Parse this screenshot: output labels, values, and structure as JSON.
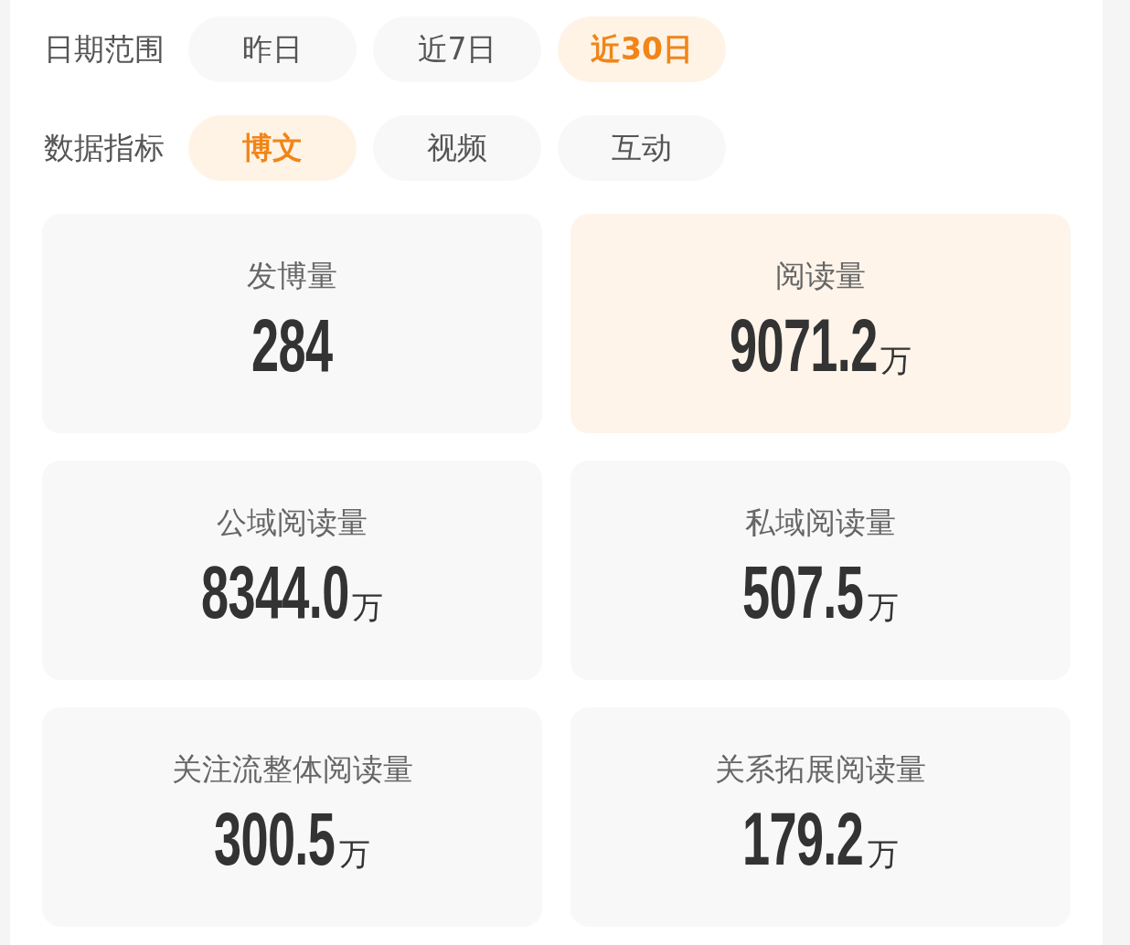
{
  "filters": [
    {
      "label": "日期范围",
      "options": [
        {
          "label": "昨日",
          "selected": false
        },
        {
          "label": "近7日",
          "selected": false
        },
        {
          "label": "近30日",
          "selected": true
        }
      ]
    },
    {
      "label": "数据指标",
      "options": [
        {
          "label": "博文",
          "selected": true
        },
        {
          "label": "视频",
          "selected": false
        },
        {
          "label": "互动",
          "selected": false
        }
      ]
    }
  ],
  "metrics": [
    {
      "label": "发博量",
      "value": "284",
      "selected": false
    },
    {
      "label": "阅读量",
      "value": "9071.2",
      "unit": "万",
      "selected": true
    },
    {
      "label": "公域阅读量",
      "value": "8344.0",
      "unit": "万",
      "selected": false
    },
    {
      "label": "私域阅读量",
      "value": "507.5",
      "unit": "万",
      "selected": false
    },
    {
      "label": "关注流整体阅读量",
      "value": "300.5",
      "unit": "万",
      "selected": false
    },
    {
      "label": "关系拓展阅读量",
      "value": "179.2",
      "unit": "万",
      "selected": false
    }
  ]
}
